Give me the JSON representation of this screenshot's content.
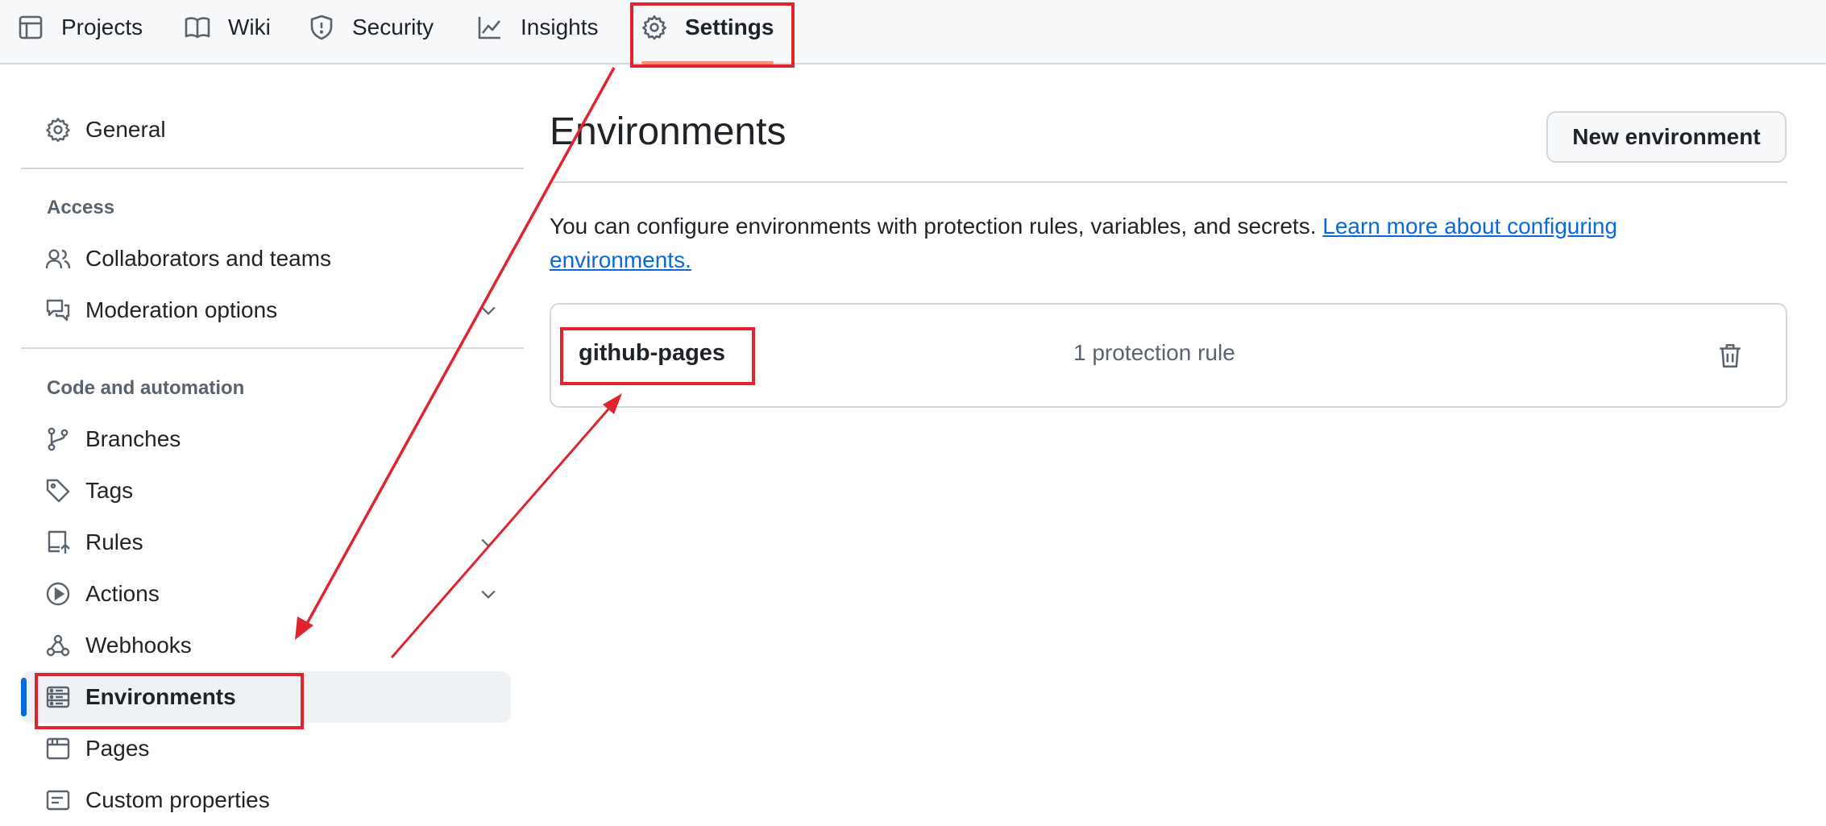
{
  "topnav": {
    "tabs": [
      {
        "label": "Projects",
        "icon": "table-icon"
      },
      {
        "label": "Wiki",
        "icon": "book-icon"
      },
      {
        "label": "Security",
        "icon": "shield-icon"
      },
      {
        "label": "Insights",
        "icon": "graph-icon"
      },
      {
        "label": "Settings",
        "icon": "gear-icon",
        "active": true
      }
    ]
  },
  "sidebar": {
    "general": "General",
    "access_heading": "Access",
    "collaborators": "Collaborators and teams",
    "moderation": "Moderation options",
    "code_heading": "Code and automation",
    "branches": "Branches",
    "tags": "Tags",
    "rules": "Rules",
    "actions": "Actions",
    "webhooks": "Webhooks",
    "environments": "Environments",
    "pages": "Pages",
    "custom_properties": "Custom properties"
  },
  "main": {
    "title": "Environments",
    "new_button": "New environment",
    "description": "You can configure environments with protection rules, variables, and secrets. ",
    "learn_more": "Learn more about configuring environments.",
    "environment": {
      "name": "github-pages",
      "rules": "1 protection rule"
    }
  },
  "colors": {
    "accent": "#0969da",
    "annotation": "#e0242e",
    "active_tab_underline": "#fd8c73"
  }
}
